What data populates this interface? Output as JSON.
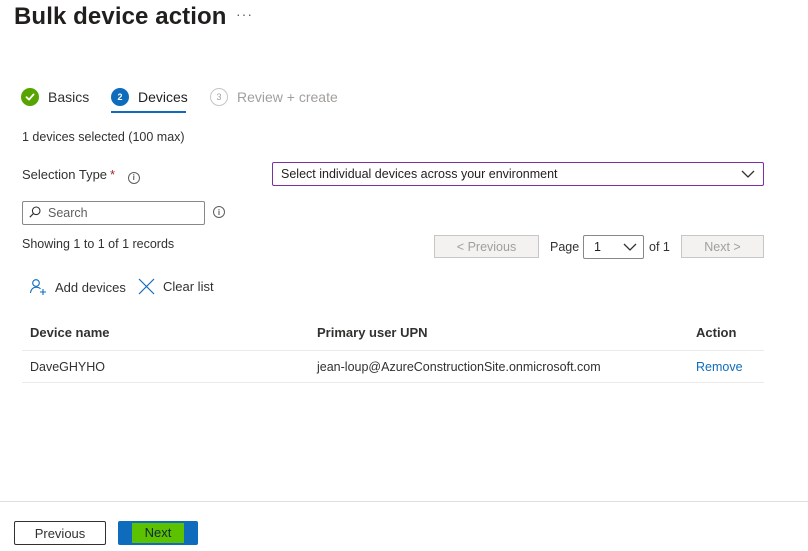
{
  "page": {
    "title": "Bulk device action",
    "more_icon": "ellipsis-icon",
    "more_glyph": "···"
  },
  "steps": [
    {
      "number": "",
      "label": "Basics",
      "state": "complete"
    },
    {
      "number": "2",
      "label": "Devices",
      "state": "active"
    },
    {
      "number": "3",
      "label": "Review + create",
      "state": "upcoming"
    }
  ],
  "devices_selected_text": "1 devices selected (100 max)",
  "selection_type": {
    "label": "Selection Type",
    "required_mark": "*",
    "info_glyph": "i",
    "value": "Select individual devices across your environment"
  },
  "search": {
    "placeholder": "Search",
    "value": "",
    "info_glyph": "i"
  },
  "records": {
    "showing_text": "Showing 1 to 1 of 1 records"
  },
  "pager": {
    "previous_label": "< Previous",
    "page_label": "Page",
    "page_value": "1",
    "of_label": "of 1",
    "next_label": "Next >"
  },
  "commands": {
    "add_label": "Add devices",
    "clear_label": "Clear list"
  },
  "table": {
    "headers": [
      "Device name",
      "Primary user UPN",
      "Action"
    ],
    "rows": [
      {
        "device_name": "DaveGHYHO",
        "upn": "jean-loup@AzureConstructionSite.onmicrosoft.com",
        "action": "Remove"
      }
    ]
  },
  "footer": {
    "previous_label": "Previous",
    "next_label": "Next"
  },
  "colors": {
    "accent": "#0f6cbd",
    "complete": "#57a300",
    "select_border": "#7a2fa5",
    "next_highlight": "#5cc200",
    "required": "#a4262c"
  }
}
